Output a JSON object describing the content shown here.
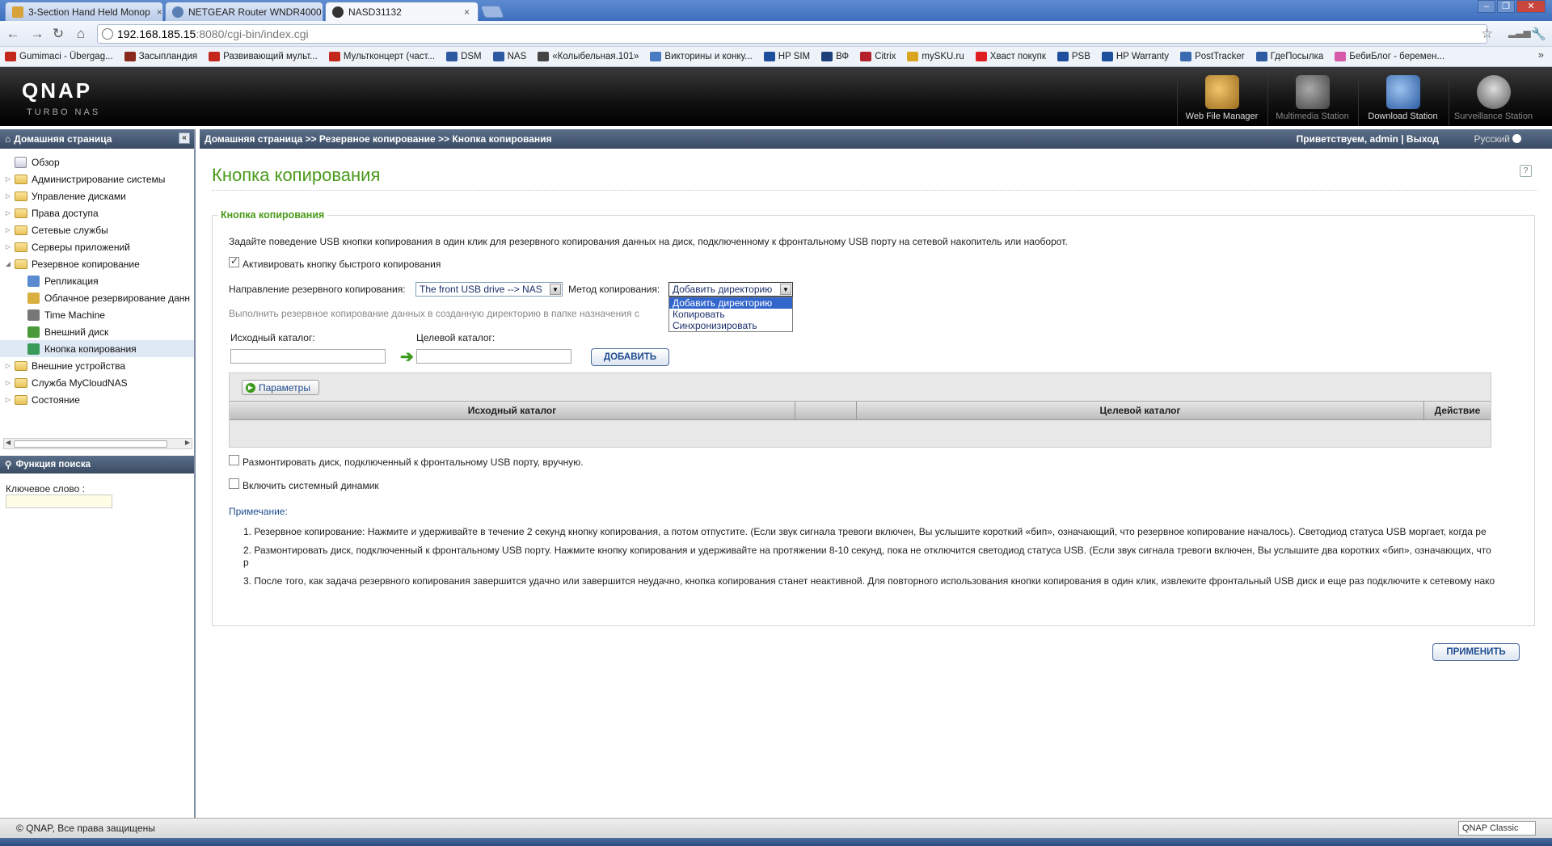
{
  "browser": {
    "tabs": [
      {
        "label": "3-Section Hand Held Monop",
        "close": "×",
        "color": "#d8a23a"
      },
      {
        "label": "NETGEAR Router WNDR4000",
        "close": "×",
        "color": "#5a7fb5"
      },
      {
        "label": "NASD31132",
        "close": "×",
        "color": "#333333"
      }
    ],
    "address": {
      "host": "192.168.185.15",
      "path": ":8080/cgi-bin/index.cgi"
    },
    "nav": {
      "back": "←",
      "forward": "→",
      "reload": "↻",
      "home": "⌂",
      "star": "☆",
      "wrench": "🔧"
    },
    "bookmarks": [
      {
        "label": "Gumimaci - Übergag...",
        "color": "#c4281c"
      },
      {
        "label": "Засыпландия",
        "color": "#8a2a1c"
      },
      {
        "label": "Развивающий мульт...",
        "color": "#c4281c"
      },
      {
        "label": "Мультконцерт (част...",
        "color": "#c4281c"
      },
      {
        "label": "DSM",
        "color": "#2d5aa0"
      },
      {
        "label": "NAS",
        "color": "#2d5aa0"
      },
      {
        "label": "«Колыбельная.101»",
        "color": "#444444"
      },
      {
        "label": "Викторины и конку...",
        "color": "#4a7ac4"
      },
      {
        "label": "HP SIM",
        "color": "#1d4f9c"
      },
      {
        "label": "ВФ",
        "color": "#1d3f7a"
      },
      {
        "label": "Citrix",
        "color": "#b5202a"
      },
      {
        "label": "mySKU.ru",
        "color": "#d9a520"
      },
      {
        "label": "Хваст покупк",
        "color": "#e02020"
      },
      {
        "label": "PSB",
        "color": "#1d4f9c"
      },
      {
        "label": "HP Warranty",
        "color": "#1d4f9c"
      },
      {
        "label": "PostTracker",
        "color": "#3a6ab0"
      },
      {
        "label": "ГдеПосылка",
        "color": "#2d5aa0"
      },
      {
        "label": "БебиБлог - беремен...",
        "color": "#d65aa8"
      }
    ],
    "bookmarks_more": "»"
  },
  "header": {
    "logo": "QNAP",
    "logo_sub": "TURBO NAS",
    "stations": [
      {
        "label": "Web File Manager",
        "color": "#c9953a"
      },
      {
        "label": "Multimedia Station",
        "color": "#7a7a7a"
      },
      {
        "label": "Download Station",
        "color": "#4a7ac4"
      },
      {
        "label": "Surveillance Station",
        "color": "#9a9a9a"
      }
    ]
  },
  "sidebar": {
    "title": "Домашняя страница",
    "items": [
      {
        "label": "Обзор",
        "type": "leaf-root"
      },
      {
        "label": "Администрирование системы",
        "type": "folder"
      },
      {
        "label": "Управление дисками",
        "type": "folder"
      },
      {
        "label": "Права доступа",
        "type": "folder"
      },
      {
        "label": "Сетевые службы",
        "type": "folder"
      },
      {
        "label": "Серверы приложений",
        "type": "folder"
      },
      {
        "label": "Резервное копирование",
        "type": "folder-open"
      },
      {
        "label": "Репликация",
        "type": "leaf"
      },
      {
        "label": "Облачное резервирование данн",
        "type": "leaf"
      },
      {
        "label": "Time Machine",
        "type": "leaf"
      },
      {
        "label": "Внешний диск",
        "type": "leaf"
      },
      {
        "label": "Кнопка копирования",
        "type": "leaf",
        "selected": true
      },
      {
        "label": "Внешние устройства",
        "type": "folder"
      },
      {
        "label": "Служба MyCloudNAS",
        "type": "folder"
      },
      {
        "label": "Состояние",
        "type": "folder"
      }
    ],
    "search_title": "Функция поиска",
    "search_label": "Ключевое слово :"
  },
  "crumb": {
    "path": "Домашняя страница >> Резервное копирование >> Кнопка копирования",
    "greeting": "Приветствуем, admin | Выход",
    "language": "Русский"
  },
  "main": {
    "title": "Кнопка копирования",
    "help": "?",
    "legend": "Кнопка копирования",
    "description": "Задайте поведение USB кнопки копирования в один клик для резервного копирования данных на диск, подключенному к фронтальному USB порту на сетевой накопитель или наоборот.",
    "activate_label": "Активировать кнопку быстрого копирования",
    "direction_label": "Направление резервного копирования:",
    "direction_value": "The front USB drive --> NAS",
    "method_label": "Метод копирования:",
    "method_value": "Добавить директорию",
    "method_options": [
      "Добавить директорию",
      "Копировать",
      "Синхронизировать"
    ],
    "method_hint": "Выполнить резервное копирование данных в созданную директорию в папке назначения с",
    "source_label": "Исходный каталог:",
    "target_label": "Целевой каталог:",
    "add_button": "ДОБАВИТЬ",
    "params_button": "Параметры",
    "columns": [
      "Исходный каталог",
      "",
      "Целевой каталог",
      "Действие"
    ],
    "unmount_label": "Размонтировать диск, подключенный к фронтальному USB порту, вручную.",
    "speaker_label": "Включить системный динамик",
    "note_title": "Примечание:",
    "notes": [
      "1. Резервное копирование: Нажмите и удерживайте в течение 2 секунд кнопку копирования, а потом отпустите. (Если звук сигнала тревоги включен, Вы услышите короткий «бип», означающий, что резервное копирование началось). Светодиод статуса USB моргает, когда ре",
      "2. Размонтировать диск, подключенный к фронтальному USB порту. Нажмите кнопку копирования и удерживайте на протяжении 8-10 секунд, пока не отключится светодиод статуса USB. (Если звук сигнала тревоги включен, Вы услышите два коротких «бип», означающих, что р",
      "3. После того, как задача резервного копирования завершится удачно или завершится неудачно, кнопка копирования станет неактивной. Для повторного использования кнопки копирования в один клик, извлеките фронтальный USB диск и еще раз подключите к сетевому нако"
    ],
    "apply_button": "ПРИМЕНИТЬ"
  },
  "footer": {
    "copyright": "© QNAP, Все права защищены",
    "theme": "QNAP Classic"
  }
}
